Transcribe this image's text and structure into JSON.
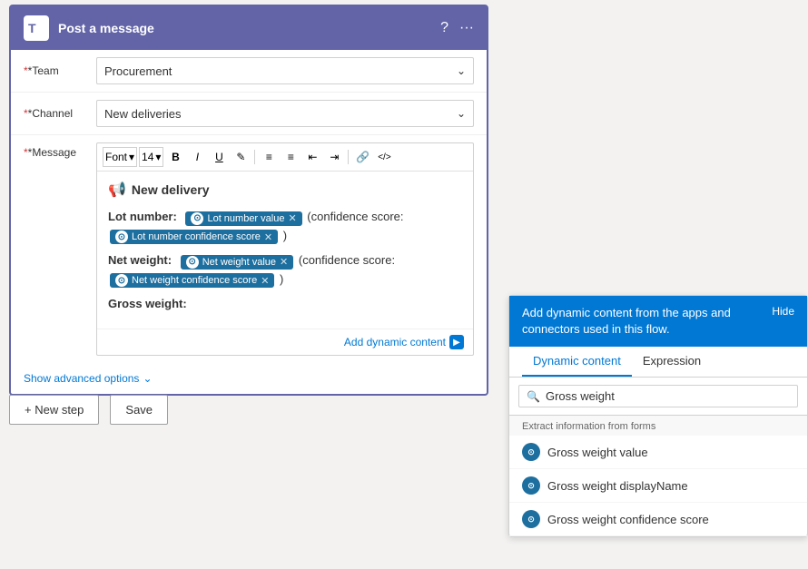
{
  "card": {
    "title": "Post a message",
    "help_icon": "?",
    "more_icon": "···"
  },
  "form": {
    "team_label": "*Team",
    "team_value": "Procurement",
    "channel_label": "*Channel",
    "channel_value": "New deliveries",
    "message_label": "*Message"
  },
  "toolbar": {
    "font_label": "Font",
    "font_size": "14",
    "bold": "B",
    "italic": "I",
    "underline": "U",
    "highlight": "✎",
    "bullet_list": "≡",
    "numbered_list": "≡",
    "decrease_indent": "⇐",
    "increase_indent": "⇒",
    "link": "🔗",
    "more": "</>",
    "strike": "⊘"
  },
  "editor": {
    "delivery_header": "New delivery",
    "lot_number_label": "Lot number:",
    "lot_number_token": "Lot number value",
    "lot_confidence_text": "(confidence score:",
    "lot_confidence_token": "Lot number confidence score",
    "lot_end": ")",
    "net_weight_label": "Net weight:",
    "net_weight_token": "Net weight value",
    "net_confidence_text": "(confidence score:",
    "net_confidence_token": "Net weight confidence score",
    "net_end": ")",
    "gross_weight_label": "Gross weight:"
  },
  "add_dynamic": {
    "label": "Add dynamic content"
  },
  "show_advanced": {
    "label": "Show advanced options"
  },
  "bottom": {
    "new_step_label": "+ New step",
    "save_label": "Save"
  },
  "dynamic_panel": {
    "header_text": "Add dynamic content from the apps and connectors used in this flow.",
    "hide_label": "Hide",
    "tab_dynamic": "Dynamic content",
    "tab_expression": "Expression",
    "search_placeholder": "Gross weight",
    "section_label": "Extract information from forms",
    "items": [
      {
        "label": "Gross weight value"
      },
      {
        "label": "Gross weight displayName"
      },
      {
        "label": "Gross weight confidence score"
      }
    ]
  }
}
